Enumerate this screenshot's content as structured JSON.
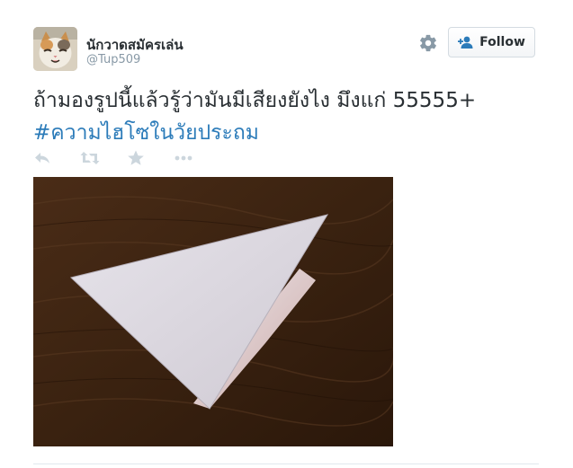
{
  "user": {
    "display_name": "นักวาดสมัครเล่น",
    "handle": "@Tup509",
    "avatar": "cat-avatar"
  },
  "header": {
    "settings_icon": "gear-icon",
    "follow_label": "Follow",
    "follow_icon": "add-user-icon"
  },
  "tweet": {
    "text": "ถ้ามองรูปนี้แล้วรู้ว่ามันมีเสียงยังไง มึงแก่ 55555+",
    "hashtag": "#ความไฮโซในวัยประถม"
  },
  "actions": [
    {
      "name": "reply",
      "icon": "reply-icon"
    },
    {
      "name": "retweet",
      "icon": "retweet-icon"
    },
    {
      "name": "favorite",
      "icon": "star-icon"
    },
    {
      "name": "more",
      "icon": "more-icon"
    }
  ],
  "media": {
    "content": "folded paper triangle on wooden table"
  },
  "colors": {
    "link": "#2b7bb9",
    "text": "#292f33",
    "muted": "#8899a6",
    "icon": "#ccd6dd"
  }
}
